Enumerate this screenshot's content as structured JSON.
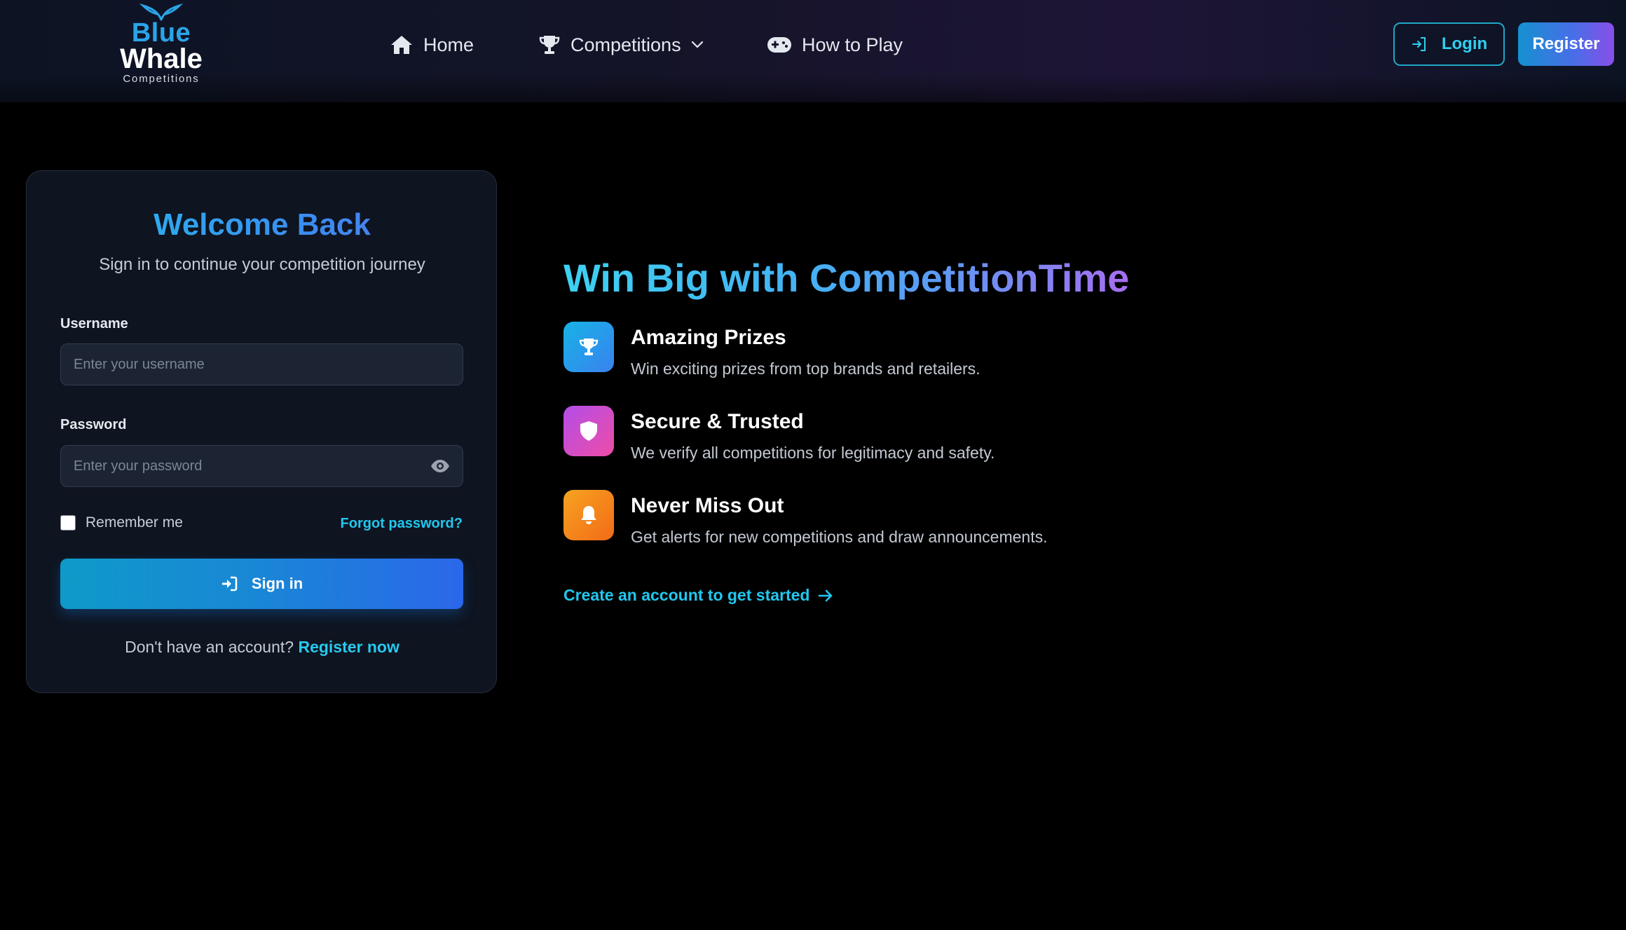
{
  "header": {
    "logo": {
      "line1": "Blue",
      "line2": "Whale",
      "line3": "Competitions"
    },
    "nav": [
      {
        "label": "Home",
        "icon": "home-icon"
      },
      {
        "label": "Competitions",
        "icon": "trophy-icon",
        "has_dropdown": true
      },
      {
        "label": "How to Play",
        "icon": "gamepad-icon"
      }
    ],
    "login_label": "Login",
    "register_label": "Register"
  },
  "login": {
    "title": "Welcome Back",
    "subtitle": "Sign in to continue your competition journey",
    "username_label": "Username",
    "username_placeholder": "Enter your username",
    "username_value": "",
    "password_label": "Password",
    "password_placeholder": "Enter your password",
    "password_value": "",
    "remember_label": "Remember me",
    "remember_checked": false,
    "forgot_label": "Forgot password?",
    "submit_label": "Sign in",
    "no_account_text": "Don't have an account?",
    "register_link": "Register now"
  },
  "hero": {
    "title": "Win Big with CompetitionTime",
    "features": [
      {
        "icon": "trophy-icon",
        "title": "Amazing Prizes",
        "description": "Win exciting prizes from top brands and retailers."
      },
      {
        "icon": "shield-icon",
        "title": "Secure & Trusted",
        "description": "We verify all competitions for legitimacy and safety."
      },
      {
        "icon": "bell-icon",
        "title": "Never Miss Out",
        "description": "Get alerts for new competitions and draw announcements."
      }
    ],
    "cta_label": "Create an account to get started"
  },
  "colors": {
    "background": "#000000",
    "accent_cyan": "#22c7ee",
    "accent_blue": "#2b67ea",
    "accent_purple": "#8a4fe8",
    "card": "#0e1420"
  }
}
